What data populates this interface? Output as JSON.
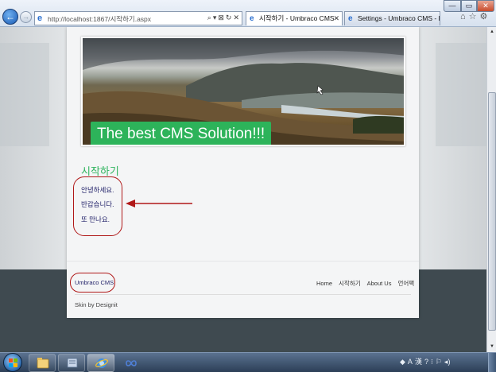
{
  "browser": {
    "address_url": "http://localhost:1867/시작하기.aspx",
    "address_tools": [
      "⌕",
      "▾",
      "⊠",
      "↻",
      "✕"
    ],
    "tabs": [
      {
        "label": "시작하기 - Umbraco CMS",
        "close": "✕"
      },
      {
        "label": "Settings - Umbraco CMS - lo...",
        "close": ""
      }
    ],
    "window_controls": {
      "minimize": "—",
      "maximize": "▭",
      "close": "✕"
    },
    "nav": {
      "back": "←",
      "forward": "→"
    },
    "command_icons": [
      "⌂",
      "☆",
      "⚙"
    ]
  },
  "page": {
    "banner_caption": "The best CMS Solution!!!",
    "section_heading": "시작하기",
    "body_lines": [
      "안녕하세요.",
      "반갑습니다.",
      "또 만나요."
    ],
    "footer": {
      "brand": "Umbraco CMS",
      "nav": [
        "Home",
        "시작하기",
        "About Us",
        "언어팩"
      ],
      "credit": "Skin by Designit"
    }
  },
  "scrollbar": {
    "up": "▲",
    "down": "▼"
  },
  "taskbar": {
    "items": [
      "explorer",
      "library",
      "internet-explorer",
      "app"
    ],
    "tray": [
      "◆",
      "A",
      "漢",
      "?",
      "⁝",
      "⚐",
      "◂)"
    ]
  },
  "colors": {
    "accent_green": "#2eb35c",
    "annotation_red": "#b01818",
    "text_navy": "#23236a"
  }
}
